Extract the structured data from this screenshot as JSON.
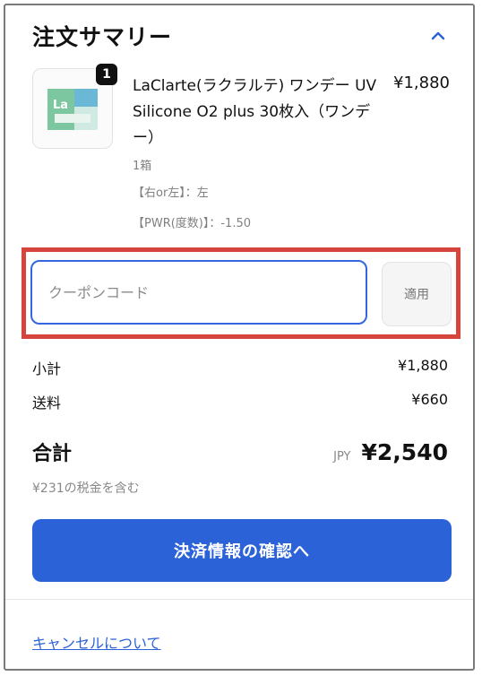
{
  "summary": {
    "title": "注文サマリー",
    "collapse_icon": "chevron-up-icon"
  },
  "item": {
    "quantity_badge": "1",
    "name": "LaClarte(ラクラルテ) ワンデー UV Silicone O2 plus 30枚入（ワンデー）",
    "price": "¥1,880",
    "meta_unit": "1箱",
    "meta_side": "【右or左】：左",
    "meta_power": "【PWR(度数)】：-1.50",
    "thumb_icon": "contact-lens-box-icon"
  },
  "coupon": {
    "placeholder": "クーポンコード",
    "apply_label": "適用"
  },
  "totals": {
    "subtotal_label": "小計",
    "subtotal_value": "¥1,880",
    "shipping_label": "送料",
    "shipping_value": "¥660",
    "total_label": "合計",
    "currency": "JPY",
    "total_value": "¥2,540",
    "tax_note": "¥231の税金を含む"
  },
  "actions": {
    "confirm_label": "決済情報の確認へ",
    "cancel_link": "キャンセルについて"
  },
  "colors": {
    "accent": "#2c62d8",
    "highlight": "#d6453d"
  }
}
